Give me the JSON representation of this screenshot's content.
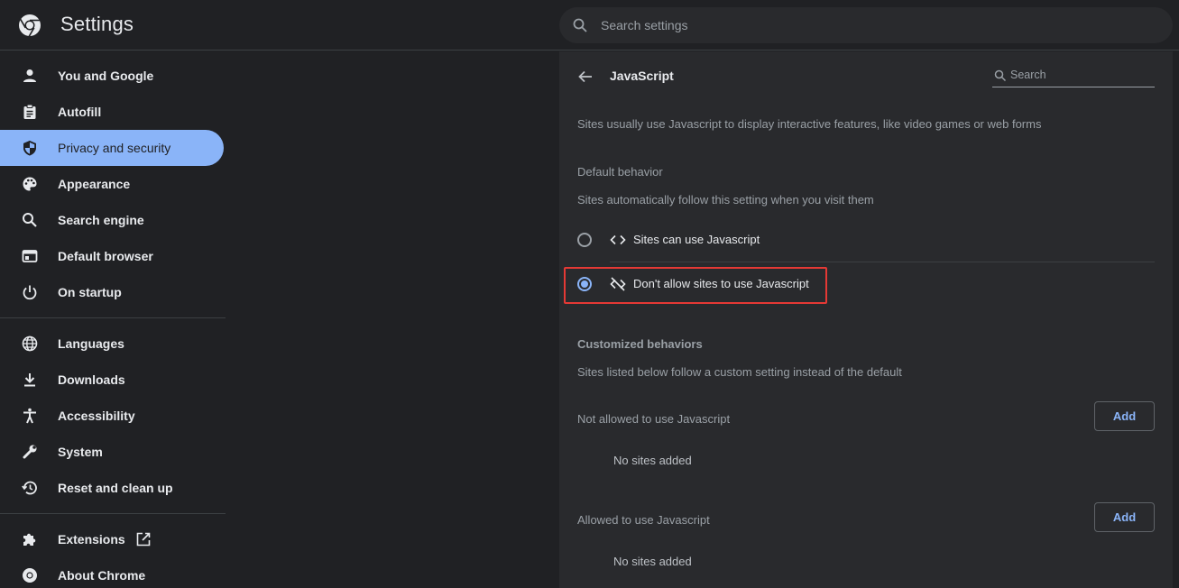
{
  "header": {
    "title": "Settings",
    "search_placeholder": "Search settings"
  },
  "sidebar": {
    "items": [
      {
        "label": "You and Google",
        "icon": "person-icon"
      },
      {
        "label": "Autofill",
        "icon": "clipboard-icon"
      },
      {
        "label": "Privacy and security",
        "icon": "shield-icon",
        "active": true
      },
      {
        "label": "Appearance",
        "icon": "palette-icon"
      },
      {
        "label": "Search engine",
        "icon": "search-icon"
      },
      {
        "label": "Default browser",
        "icon": "browser-window-icon"
      },
      {
        "label": "On startup",
        "icon": "power-icon"
      },
      {
        "label": "Languages",
        "icon": "globe-icon"
      },
      {
        "label": "Downloads",
        "icon": "download-icon"
      },
      {
        "label": "Accessibility",
        "icon": "accessibility-icon"
      },
      {
        "label": "System",
        "icon": "wrench-icon"
      },
      {
        "label": "Reset and clean up",
        "icon": "restore-icon"
      },
      {
        "label": "Extensions",
        "icon": "puzzle-icon"
      },
      {
        "label": "About Chrome",
        "icon": "chrome-icon"
      }
    ]
  },
  "main": {
    "title": "JavaScript",
    "search_placeholder": "Search",
    "description": "Sites usually use Javascript to display interactive features, like video games or web forms",
    "default_behavior": {
      "heading": "Default behavior",
      "description": "Sites automatically follow this setting when you visit them",
      "options": [
        {
          "label": "Sites can use Javascript",
          "icon": "code-icon",
          "selected": false
        },
        {
          "label": "Don't allow sites to use Javascript",
          "icon": "code-off-icon",
          "selected": true
        }
      ]
    },
    "customized": {
      "heading": "Customized behaviors",
      "description": "Sites listed below follow a custom setting instead of the default",
      "not_allowed": {
        "label": "Not allowed to use Javascript",
        "button": "Add",
        "empty": "No sites added"
      },
      "allowed": {
        "label": "Allowed to use Javascript",
        "button": "Add",
        "empty": "No sites added"
      }
    }
  },
  "colors": {
    "accent": "#8ab4f8",
    "background": "#202124",
    "panel": "#292a2d",
    "highlight_border": "#e53935"
  }
}
